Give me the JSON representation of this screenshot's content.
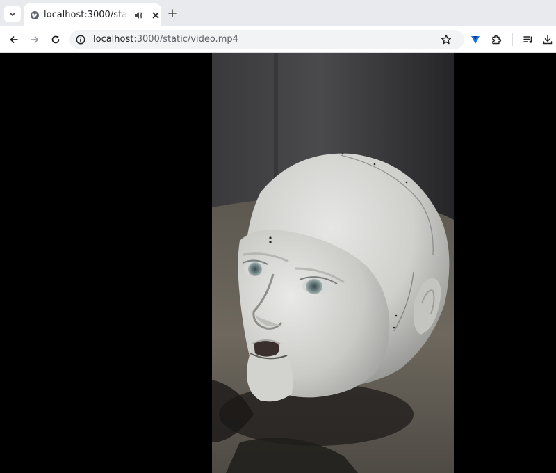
{
  "browser": {
    "tab": {
      "title": "localhost:3000/static/video.mp4",
      "favicon": "globe-icon",
      "audio": "speaker-icon",
      "close": "close-icon"
    },
    "new_tab": "plus-icon",
    "tab_search": "chevron-down-icon",
    "nav": {
      "back": "arrow-left-icon",
      "forward": "arrow-right-icon",
      "reload": "reload-icon"
    },
    "address": {
      "host": "localhost",
      "path": ":3000/static/video.mp4",
      "info": "info-icon",
      "bookmark": "star-icon"
    },
    "extensions": [
      "vpn-extension-icon",
      "puzzle-icon",
      "media-controls-icon",
      "download-icon"
    ]
  },
  "page": {
    "background": "#000000",
    "media": {
      "type": "video",
      "subject": "white humanoid robot head lying on the floor"
    }
  },
  "colors": {
    "tabstrip": "#e8eaed",
    "toolbar": "#ffffff",
    "omnibox": "#f1f3f4",
    "icon": "#474747",
    "vpn_accent": "#1a73e8"
  }
}
